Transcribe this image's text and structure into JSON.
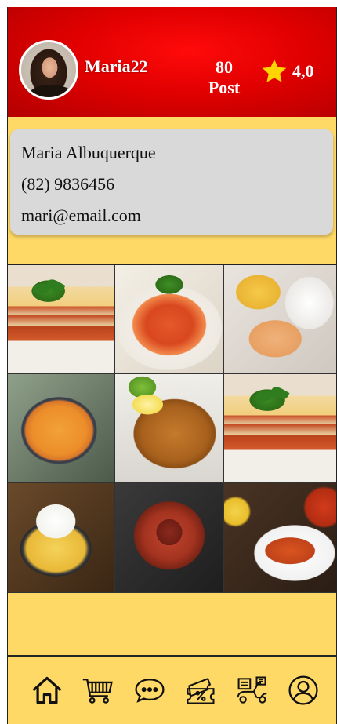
{
  "profile": {
    "username": "Maria22",
    "posts_count": "80",
    "posts_label": "Post",
    "rating": "4,0"
  },
  "contact": {
    "name": "Maria Albuquerque",
    "phone": "(82) 9836456",
    "email": "mari@email.com"
  },
  "colors": {
    "header_red": "#e10000",
    "background_yellow": "#FFD966",
    "card_gray": "#d9d9d9",
    "star_yellow": "#FFD400"
  },
  "gallery": [
    {
      "icon": "lasagna-photo"
    },
    {
      "icon": "spaghetti-photo"
    },
    {
      "icon": "stroganoff-photo"
    },
    {
      "icon": "moqueca-photo"
    },
    {
      "icon": "milanesa-photo"
    },
    {
      "icon": "lasagna-photo"
    },
    {
      "icon": "rice-stew-photo"
    },
    {
      "icon": "octopus-photo"
    },
    {
      "icon": "lobster-photo"
    }
  ],
  "nav": [
    {
      "icon": "home-icon"
    },
    {
      "icon": "cart-icon"
    },
    {
      "icon": "chat-icon"
    },
    {
      "icon": "coupon-icon"
    },
    {
      "icon": "delivery-icon"
    },
    {
      "icon": "profile-icon"
    }
  ]
}
